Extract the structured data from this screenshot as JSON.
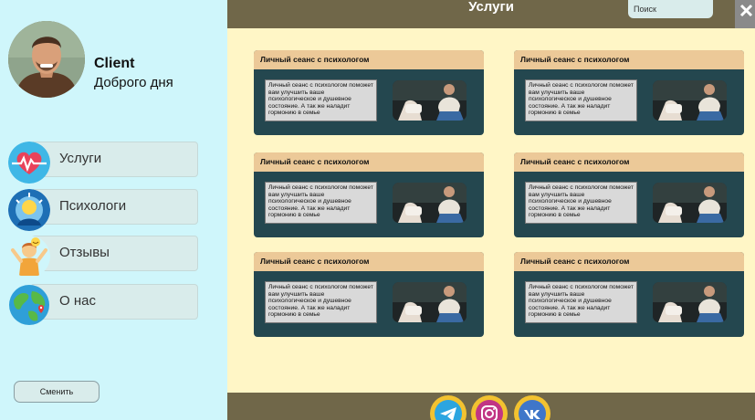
{
  "sidebar": {
    "user_name": "Client",
    "greeting": "Доброго дня",
    "nav": [
      {
        "label": "Услуги",
        "icon": "heartbeat-icon"
      },
      {
        "label": "Психологи",
        "icon": "brain-icon"
      },
      {
        "label": "Отзывы",
        "icon": "happy-person-icon"
      },
      {
        "label": "О нас",
        "icon": "globe-icon"
      }
    ],
    "switch_label": "Сменить"
  },
  "header": {
    "title": "Услуги",
    "search_placeholder": "Поиск"
  },
  "cards": [
    {
      "title": "Личный сеанс с психологом",
      "text": "Личный сеанс с психологом поможет вам улучшить ваше психологическое и душевное состояние. А так же наладит гормонию в семье"
    },
    {
      "title": "Личный сеанс с психологом",
      "text": "Личный сеанс с психологом поможет вам улучшить ваше психологическое и душевное состояние. А так же наладит гормонию в семье"
    },
    {
      "title": "Личный сеанс с психологом",
      "text": "Личный сеанс с психологом поможет вам улучшить ваше психологическое и душевное состояние. А так же наладит гормонию в семье"
    },
    {
      "title": "Личный сеанс с психологом",
      "text": "Личный сеанс с психологом поможет вам улучшить ваше психологическое и душевное состояние. А так же наладит гормонию в семье"
    },
    {
      "title": "Личный сеанс с психологом",
      "text": "Личный сеанс с психологом поможет вам улучшить ваше психологическое и душевное состояние. А так же наладит гормонию в семье"
    },
    {
      "title": "Личный сеанс с психологом",
      "text": "Личный сеанс с психологом поможет вам улучшить ваше психологическое и душевное состояние. А так же наладит гормонию в семье"
    }
  ],
  "footer": {
    "socials": [
      "telegram-icon",
      "instagram-icon",
      "vk-icon"
    ]
  },
  "colors": {
    "sidebar_bg": "#cff6fb",
    "main_bg": "#fff6c6",
    "bar_bg": "#706749",
    "card_bg": "#24474f",
    "card_head": "#ecc998",
    "social_ring": "#f2c230"
  }
}
